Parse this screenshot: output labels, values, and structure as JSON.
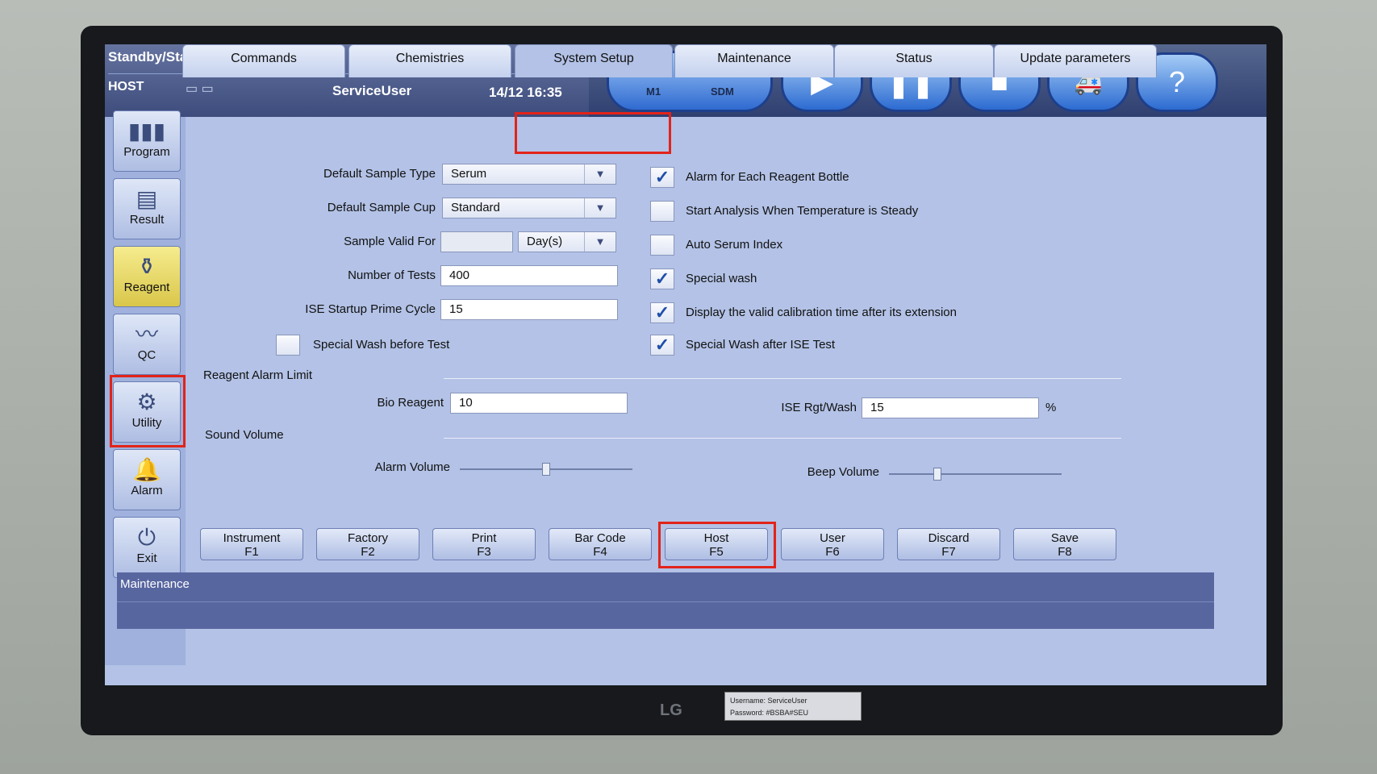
{
  "header": {
    "status": "Standby/Standby",
    "host": "HOST",
    "user": "ServiceUser",
    "datetime": "14/12 16:35",
    "modules": [
      "M1",
      "SDM"
    ]
  },
  "toolbar": [
    "play",
    "pause",
    "stop",
    "ambulance",
    "help"
  ],
  "sidebar": [
    {
      "label": "Program",
      "icon": "bars-icon"
    },
    {
      "label": "Result",
      "icon": "table-icon"
    },
    {
      "label": "Reagent",
      "icon": "bottles-icon"
    },
    {
      "label": "QC",
      "icon": "chart-icon"
    },
    {
      "label": "Utility",
      "icon": "utility-icon"
    },
    {
      "label": "Alarm",
      "icon": "bell-icon"
    },
    {
      "label": "Exit",
      "icon": "power-icon"
    }
  ],
  "tabs": [
    "Commands",
    "Chemistries",
    "System Setup",
    "Maintenance",
    "Status",
    "Update parameters"
  ],
  "form": {
    "sample_type_label": "Default Sample Type",
    "sample_type": "Serum",
    "sample_cup_label": "Default Sample Cup",
    "sample_cup": "Standard",
    "valid_for_label": "Sample Valid For",
    "valid_for_value": "",
    "valid_for_unit": "Day(s)",
    "num_tests_label": "Number of Tests",
    "num_tests": "400",
    "ise_prime_label": "ISE Startup Prime Cycle",
    "ise_prime": "15",
    "special_wash_before": "Special Wash before Test",
    "reagent_alarm_label": "Reagent Alarm Limit",
    "bio_reagent_label": "Bio Reagent",
    "bio_reagent": "10",
    "ise_rgt_label": "ISE Rgt/Wash",
    "ise_rgt": "15",
    "percent": "%",
    "sound_volume_label": "Sound Volume",
    "alarm_volume_label": "Alarm Volume",
    "alarm_volume": 0.5,
    "beep_volume_label": "Beep Volume",
    "beep_volume": 0.28
  },
  "checkboxes": [
    {
      "label": "Alarm for Each Reagent Bottle",
      "checked": true
    },
    {
      "label": "Start Analysis When Temperature is Steady",
      "checked": false
    },
    {
      "label": "Auto Serum Index",
      "checked": false
    },
    {
      "label": "Special wash",
      "checked": true
    },
    {
      "label": "Display the valid calibration time after its extension",
      "checked": true
    },
    {
      "label": "Special Wash after ISE Test",
      "checked": true
    }
  ],
  "fbuttons": [
    {
      "label": "Instrument",
      "key": "F1"
    },
    {
      "label": "Factory",
      "key": "F2"
    },
    {
      "label": "Print",
      "key": "F3"
    },
    {
      "label": "Bar Code",
      "key": "F4"
    },
    {
      "label": "Host",
      "key": "F5"
    },
    {
      "label": "User",
      "key": "F6"
    },
    {
      "label": "Discard",
      "key": "F7"
    },
    {
      "label": "Save",
      "key": "F8"
    }
  ],
  "statusbar": "Maintenance",
  "monitor_brand": "LG",
  "sticker": {
    "line1": "Username: ServiceUser",
    "line2": "Password: #BSBA#SEU"
  },
  "colors": {
    "highlight": "#e2231a",
    "accent": "#1f4fa8",
    "panel": "#b3c2e6"
  }
}
